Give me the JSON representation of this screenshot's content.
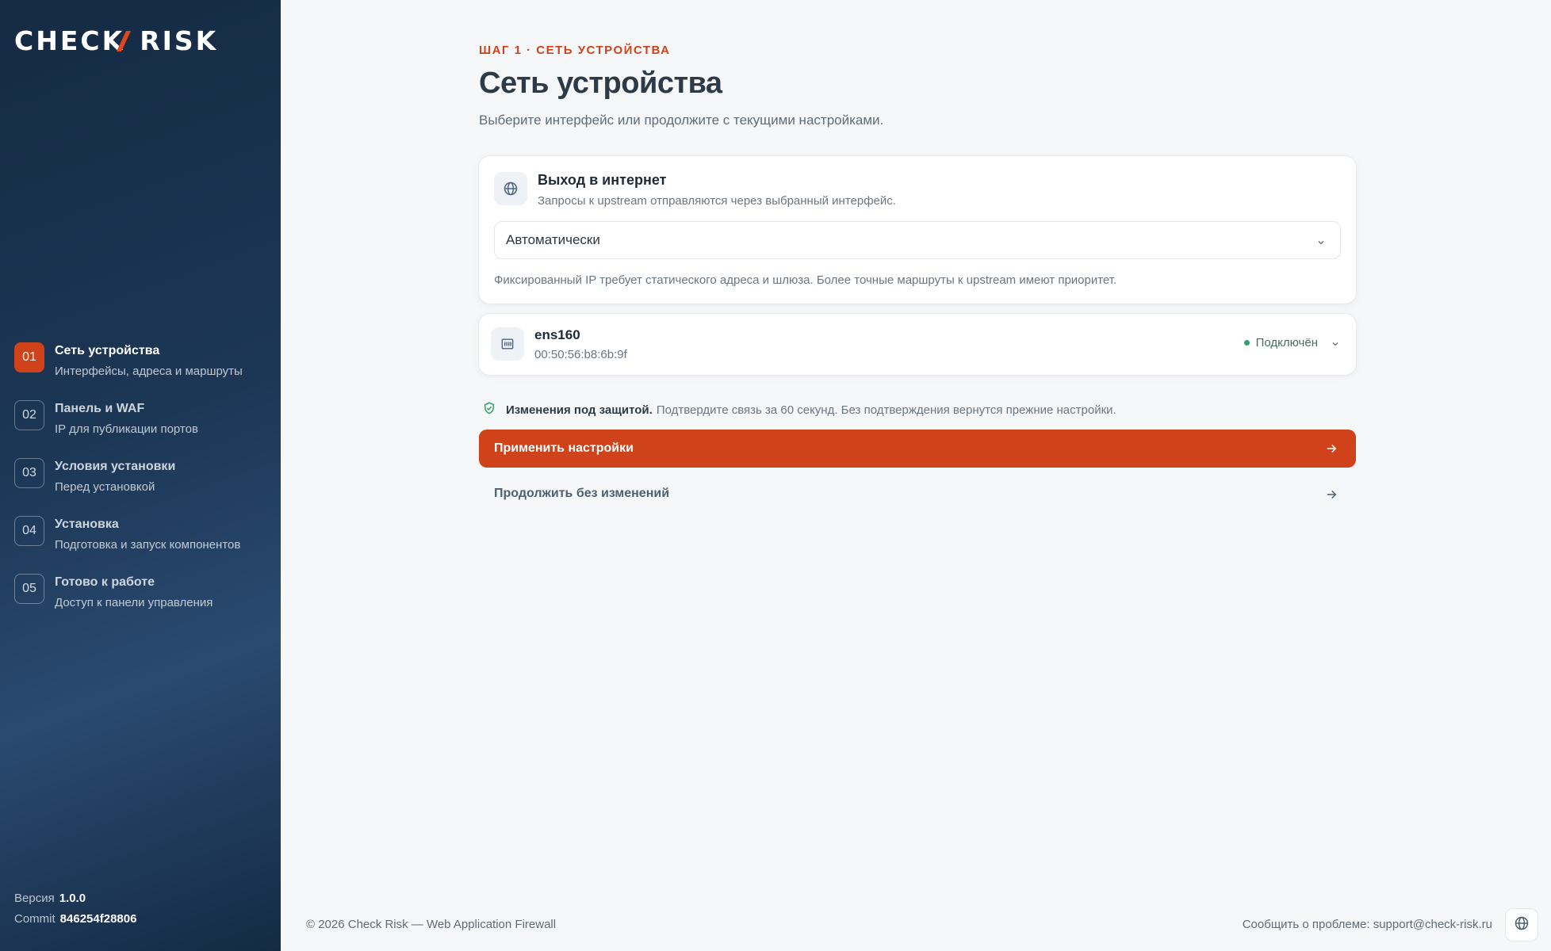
{
  "brand": {
    "logo_text_left": "CHEC",
    "logo_text_right": "RISK",
    "logo_k": "K",
    "accent": "#cf421a"
  },
  "sidebar": {
    "steps": [
      {
        "num": "01",
        "title": "Сеть устройства",
        "subtitle": "Интерфейсы, адреса и маршруты",
        "active": true
      },
      {
        "num": "02",
        "title": "Панель и WAF",
        "subtitle": "IP для публикации портов",
        "active": false
      },
      {
        "num": "03",
        "title": "Условия установки",
        "subtitle": "Перед установкой",
        "active": false
      },
      {
        "num": "04",
        "title": "Установка",
        "subtitle": "Подготовка и запуск компонентов",
        "active": false
      },
      {
        "num": "05",
        "title": "Готово к работе",
        "subtitle": "Доступ к панели управления",
        "active": false
      }
    ],
    "version_label": "Версия",
    "version_value": "1.0.0",
    "commit_label": "Commit",
    "commit_value": "846254f28806"
  },
  "main": {
    "kicker": "ШАГ 1 · СЕТЬ УСТРОЙСТВА",
    "title": "Сеть устройства",
    "lead": "Выберите интерфейс или продолжите с текущими настройками.",
    "internet": {
      "icon": "globe-icon",
      "title": "Выход в интернет",
      "subtitle": "Запросы к upstream отправляются через выбранный интерфейс.",
      "select_value": "Автоматически",
      "hint": "Фиксированный IP требует статического адреса и шлюза. Более точные маршруты к upstream имеют приоритет."
    },
    "interface": {
      "icon": "network-card-icon",
      "name": "ens160",
      "mac": "00:50:56:b8:6b:9f",
      "status": "Подключён",
      "status_color": "#2fa36b"
    },
    "protection": {
      "icon": "shield-check-icon",
      "bold": "Изменения под защитой.",
      "text": "Подтвердите связь за 60 секунд. Без подтверждения вернутся прежние настройки."
    },
    "apply_label": "Применить настройки",
    "skip_label": "Продолжить без изменений"
  },
  "footer": {
    "copyright": "© 2026 Check Risk — Web Application Firewall",
    "report_label": "Сообщить о проблеме: support@check-risk.ru",
    "lang_icon": "globe-icon"
  }
}
